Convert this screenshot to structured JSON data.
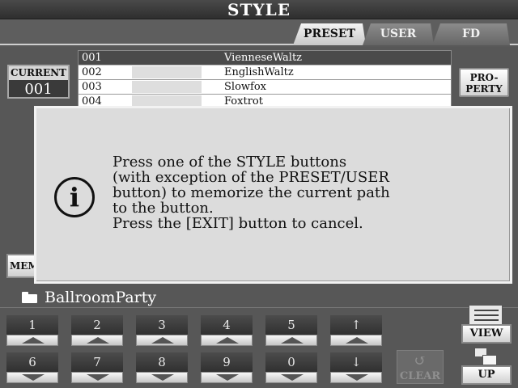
{
  "title": "STYLE",
  "tabs": [
    {
      "label": "PRESET",
      "active": true
    },
    {
      "label": "USER",
      "active": false
    },
    {
      "label": "FD",
      "active": false
    }
  ],
  "current": {
    "label": "CURRENT",
    "value": "001"
  },
  "list": [
    {
      "num": "001",
      "name": "VienneseWaltz",
      "selected": true
    },
    {
      "num": "002",
      "name": "EnglishWaltz",
      "selected": false
    },
    {
      "num": "003",
      "name": "Slowfox",
      "selected": false
    },
    {
      "num": "004",
      "name": "Foxtrot",
      "selected": false
    }
  ],
  "property_button": {
    "line1": "PRO-",
    "line2": "PERTY"
  },
  "memory_button": {
    "label": "MEM"
  },
  "dialog": {
    "icon": "info-icon",
    "lines": [
      "Press one of the STYLE buttons",
      "(with exception of the PRESET/USER",
      "button) to memorize the current path",
      "to the button.",
      "Press the [EXIT] button to cancel."
    ]
  },
  "folder": {
    "icon": "folder-icon",
    "name": "BallroomParty"
  },
  "upper_buttons": [
    "1",
    "2",
    "3",
    "4",
    "5",
    "↑"
  ],
  "lower_buttons": [
    "6",
    "7",
    "8",
    "9",
    "0",
    "↓"
  ],
  "clear_button": {
    "label": "CLEAR",
    "icon": "undo-icon"
  },
  "view_button": {
    "label": "VIEW",
    "icon": "list-view-icon"
  },
  "up_button": {
    "label": "UP",
    "icon": "folder-up-icon"
  }
}
